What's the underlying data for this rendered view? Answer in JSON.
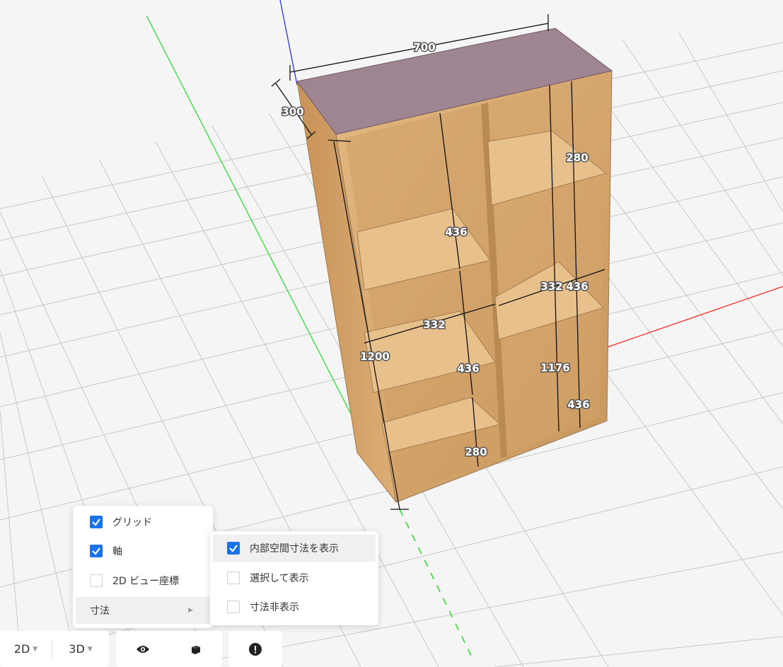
{
  "viewport": {
    "dimensions": {
      "width": "700",
      "depth": "300",
      "height_left": "1200",
      "height_right": "1176",
      "left_top_inner": "436",
      "left_mid_inner": "436",
      "left_bottom_inner": "280",
      "right_top_inner": "280",
      "right_mid_inner": "436",
      "right_bottom_inner": "436",
      "left_depth_inner": "332",
      "right_depth_inner": "332"
    }
  },
  "view_menu": {
    "items": [
      {
        "label": "グリッド",
        "checked": true
      },
      {
        "label": "軸",
        "checked": true
      },
      {
        "label": "2D ビュー座標",
        "checked": false
      },
      {
        "label": "寸法",
        "has_submenu": true
      }
    ]
  },
  "dim_submenu": {
    "items": [
      {
        "label": "内部空間寸法を表示",
        "checked": true
      },
      {
        "label": "選択して表示",
        "checked": false
      },
      {
        "label": "寸法非表示",
        "checked": false
      }
    ]
  },
  "toolbar": {
    "btn_2d": "2D",
    "btn_3d": "3D",
    "eye_icon": "eye-icon",
    "cube_icon": "cube-icon",
    "alert_icon": "alert-icon"
  },
  "colors": {
    "accent": "#1a73e8",
    "axis_x": "#ff2020",
    "axis_y": "#20e020",
    "axis_z": "#2020ff",
    "wood": "#d9ab72",
    "top_panel": "#9f8592"
  }
}
